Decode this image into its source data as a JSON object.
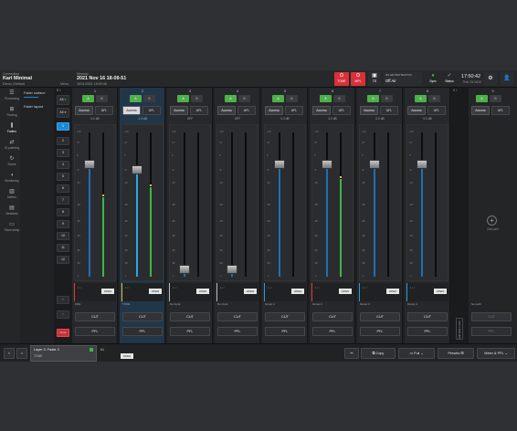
{
  "topbar": {
    "connection_label": "Connection",
    "user_name": "Karl Minimal",
    "user_sub": "Demo | Default",
    "menu_label": "Menu",
    "memory_label": "Memory",
    "memory_title": "2021 Nov 16 18-09-51",
    "memory_sub": "16/11/2021 18:09:48",
    "tone_label": "TONE",
    "mpl_label": "MPL",
    "ts_label": "TS",
    "onair_label": "ON AIR PROTECTION",
    "onair_value": "Off Air",
    "sync_label": "Sync",
    "status_label": "Status",
    "time": "17:50:42",
    "date": "THU 25 NOV"
  },
  "sidebar": {
    "items": [
      {
        "label": "Processing",
        "icon": "sliders-icon"
      },
      {
        "label": "Routing",
        "icon": "routing-icon"
      },
      {
        "label": "Faders",
        "icon": "faders-icon"
      },
      {
        "label": "IO-patching",
        "icon": "patch-icon"
      },
      {
        "label": "Scene",
        "icon": "scene-icon"
      },
      {
        "label": "Monitoring",
        "icon": "speaker-icon"
      },
      {
        "label": "Meters",
        "icon": "meters-icon"
      },
      {
        "label": "Metadata",
        "icon": "metadata-icon"
      },
      {
        "label": "Show setup",
        "icon": "setup-icon"
      }
    ],
    "active_index": 2
  },
  "subpanel": {
    "items": [
      "Fader surface",
      "Fader layout"
    ]
  },
  "banks": {
    "header": "B 1",
    "all_a": "All",
    "all_b": "All",
    "numbers": [
      "1",
      "2",
      "3",
      "4",
      "5",
      "6",
      "7",
      "8",
      "9",
      "10",
      "11",
      "12"
    ],
    "selected": 0,
    "close_label": "Close"
  },
  "strips": [
    {
      "num": "1",
      "val": "0.0 dB",
      "name": "FOH",
      "fader": 0.78,
      "meter": 0.55,
      "access": "Access",
      "afl": "AFL",
      "a": "A",
      "b": "B",
      "cut": "CUT",
      "pfl": "PFL",
      "accent": "#e33b3b",
      "selected": false,
      "open": "OPEN"
    },
    {
      "num": "2",
      "val": "-1.5 dB",
      "name": "TONE",
      "fader": 0.74,
      "meter": 0.62,
      "access": "Access",
      "afl": "AFL",
      "a": "A",
      "b": "B",
      "cut": "CUT",
      "pfl": "PFL",
      "accent": "#e3c23b",
      "selected": true,
      "open": "OPEN"
    },
    {
      "num": "3",
      "val": "OFF",
      "name": "No Input",
      "fader": 0.05,
      "meter": 0.0,
      "access": "Access",
      "afl": "AFL",
      "a": "A",
      "b": "B",
      "cut": "CUT",
      "pfl": "PFL",
      "accent": "#bbbbbb",
      "selected": false,
      "open": "OPEN"
    },
    {
      "num": "4",
      "val": "OFF",
      "name": "No Input",
      "fader": 0.05,
      "meter": 0.0,
      "access": "Access",
      "afl": "AFL",
      "a": "A",
      "b": "B",
      "cut": "CUT",
      "pfl": "PFL",
      "accent": "#bbbbbb",
      "selected": false,
      "open": "OPEN"
    },
    {
      "num": "5",
      "val": "0.0 dB",
      "name": "Group 1",
      "fader": 0.78,
      "meter": 0.0,
      "access": "Access",
      "afl": "AFL",
      "a": "A",
      "b": "B",
      "cut": "CUT",
      "pfl": "PFL",
      "accent": "#2a9bd8",
      "selected": false,
      "open": "OPEN"
    },
    {
      "num": "6",
      "val": "0.0 dB",
      "name": "Group 2",
      "fader": 0.78,
      "meter": 0.68,
      "access": "Access",
      "afl": "AFL",
      "a": "A",
      "b": "B",
      "cut": "CUT",
      "pfl": "PFL",
      "accent": "#e33b3b",
      "selected": false,
      "open": "OPEN"
    },
    {
      "num": "7",
      "val": "0.0 dB",
      "name": "Group 3",
      "fader": 0.78,
      "meter": 0.0,
      "access": "Access",
      "afl": "AFL",
      "a": "A",
      "b": "B",
      "cut": "CUT",
      "pfl": "PFL",
      "accent": "#2a9bd8",
      "selected": false,
      "open": "OPEN"
    },
    {
      "num": "8",
      "val": "0.0 dB",
      "name": "Group 4",
      "fader": 0.78,
      "meter": 0.0,
      "access": "Access",
      "afl": "AFL",
      "a": "A",
      "b": "B",
      "cut": "CUT",
      "pfl": "PFL",
      "accent": "#2a9bd8",
      "selected": false,
      "open": "OPEN"
    }
  ],
  "scale": [
    "+10",
    "+5",
    "0",
    "-5",
    "-10",
    "-20",
    "-30",
    "-40",
    "-50",
    "-60",
    "-∞"
  ],
  "gap": {
    "header": "B 1",
    "add_label": "Add faders strip"
  },
  "addpath": {
    "num": "9",
    "a": "A",
    "b": "B",
    "access": "Access",
    "afl": "AFL",
    "add_label": "Add path",
    "name": "No path",
    "cut": "CUT",
    "pfl": "PFL"
  },
  "bottombar": {
    "prev": "<",
    "next": ">",
    "layer_title": "Layer 3: Fader 2",
    "layer_sub": "TONE",
    "ab_label": "A1",
    "open_label": "OPEN",
    "copy": "Copy",
    "full": "Full",
    "presets": "Presets",
    "meter_pfl": "Meter & PFL"
  }
}
